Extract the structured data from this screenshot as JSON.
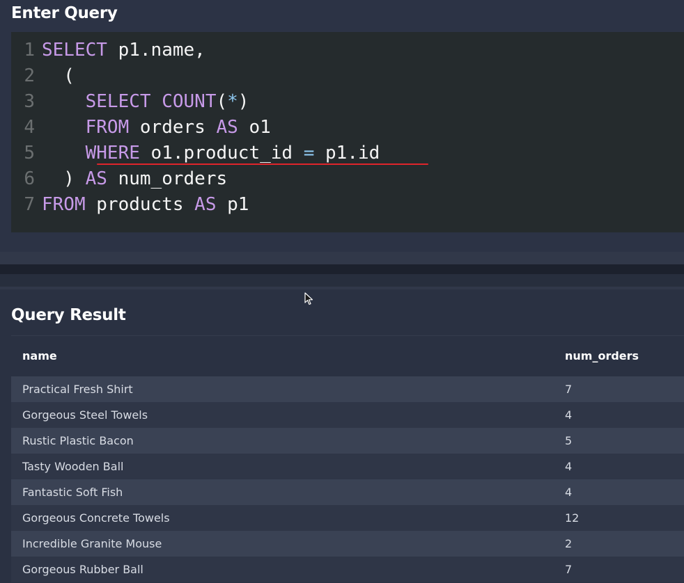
{
  "query_panel": {
    "title": "Enter Query",
    "code_lines": [
      {
        "num": "1",
        "tokens": [
          {
            "t": "SELECT",
            "k": "kw"
          },
          {
            "t": " p1.name,",
            "k": ""
          }
        ]
      },
      {
        "num": "2",
        "tokens": [
          {
            "t": "  (",
            "k": ""
          }
        ]
      },
      {
        "num": "3",
        "tokens": [
          {
            "t": "    ",
            "k": ""
          },
          {
            "t": "SELECT",
            "k": "kw"
          },
          {
            "t": " ",
            "k": ""
          },
          {
            "t": "COUNT",
            "k": "kw"
          },
          {
            "t": "(",
            "k": ""
          },
          {
            "t": "*",
            "k": "op"
          },
          {
            "t": ")",
            "k": ""
          }
        ]
      },
      {
        "num": "4",
        "tokens": [
          {
            "t": "    ",
            "k": ""
          },
          {
            "t": "FROM",
            "k": "kw"
          },
          {
            "t": " orders ",
            "k": ""
          },
          {
            "t": "AS",
            "k": "kw"
          },
          {
            "t": " o1",
            "k": ""
          }
        ]
      },
      {
        "num": "5",
        "tokens": [
          {
            "t": "    ",
            "k": ""
          },
          {
            "t": "WHERE",
            "k": "kw"
          },
          {
            "t": " o1.product_id ",
            "k": ""
          },
          {
            "t": "=",
            "k": "op"
          },
          {
            "t": " p1.id",
            "k": ""
          }
        ]
      },
      {
        "num": "6",
        "tokens": [
          {
            "t": "  ) ",
            "k": ""
          },
          {
            "t": "AS",
            "k": "kw"
          },
          {
            "t": " num_orders",
            "k": ""
          }
        ]
      },
      {
        "num": "7",
        "tokens": [
          {
            "t": "FROM",
            "k": "kw"
          },
          {
            "t": " products ",
            "k": ""
          },
          {
            "t": "AS",
            "k": "kw"
          },
          {
            "t": " p1",
            "k": ""
          }
        ]
      }
    ]
  },
  "result_panel": {
    "title": "Query Result",
    "columns": [
      "name",
      "num_orders"
    ],
    "rows": [
      [
        "Practical Fresh Shirt",
        "7"
      ],
      [
        "Gorgeous Steel Towels",
        "4"
      ],
      [
        "Rustic Plastic Bacon",
        "5"
      ],
      [
        "Tasty Wooden Ball",
        "4"
      ],
      [
        "Fantastic Soft Fish",
        "4"
      ],
      [
        "Gorgeous Concrete Towels",
        "12"
      ],
      [
        "Incredible Granite Mouse",
        "2"
      ],
      [
        "Gorgeous Rubber Ball",
        "7"
      ]
    ]
  },
  "colors": {
    "keyword": "#c79ae8",
    "operator": "#8ec8f0",
    "error_underline": "#e0242b"
  },
  "icons": {
    "cursor": "mouse-pointer-icon"
  }
}
